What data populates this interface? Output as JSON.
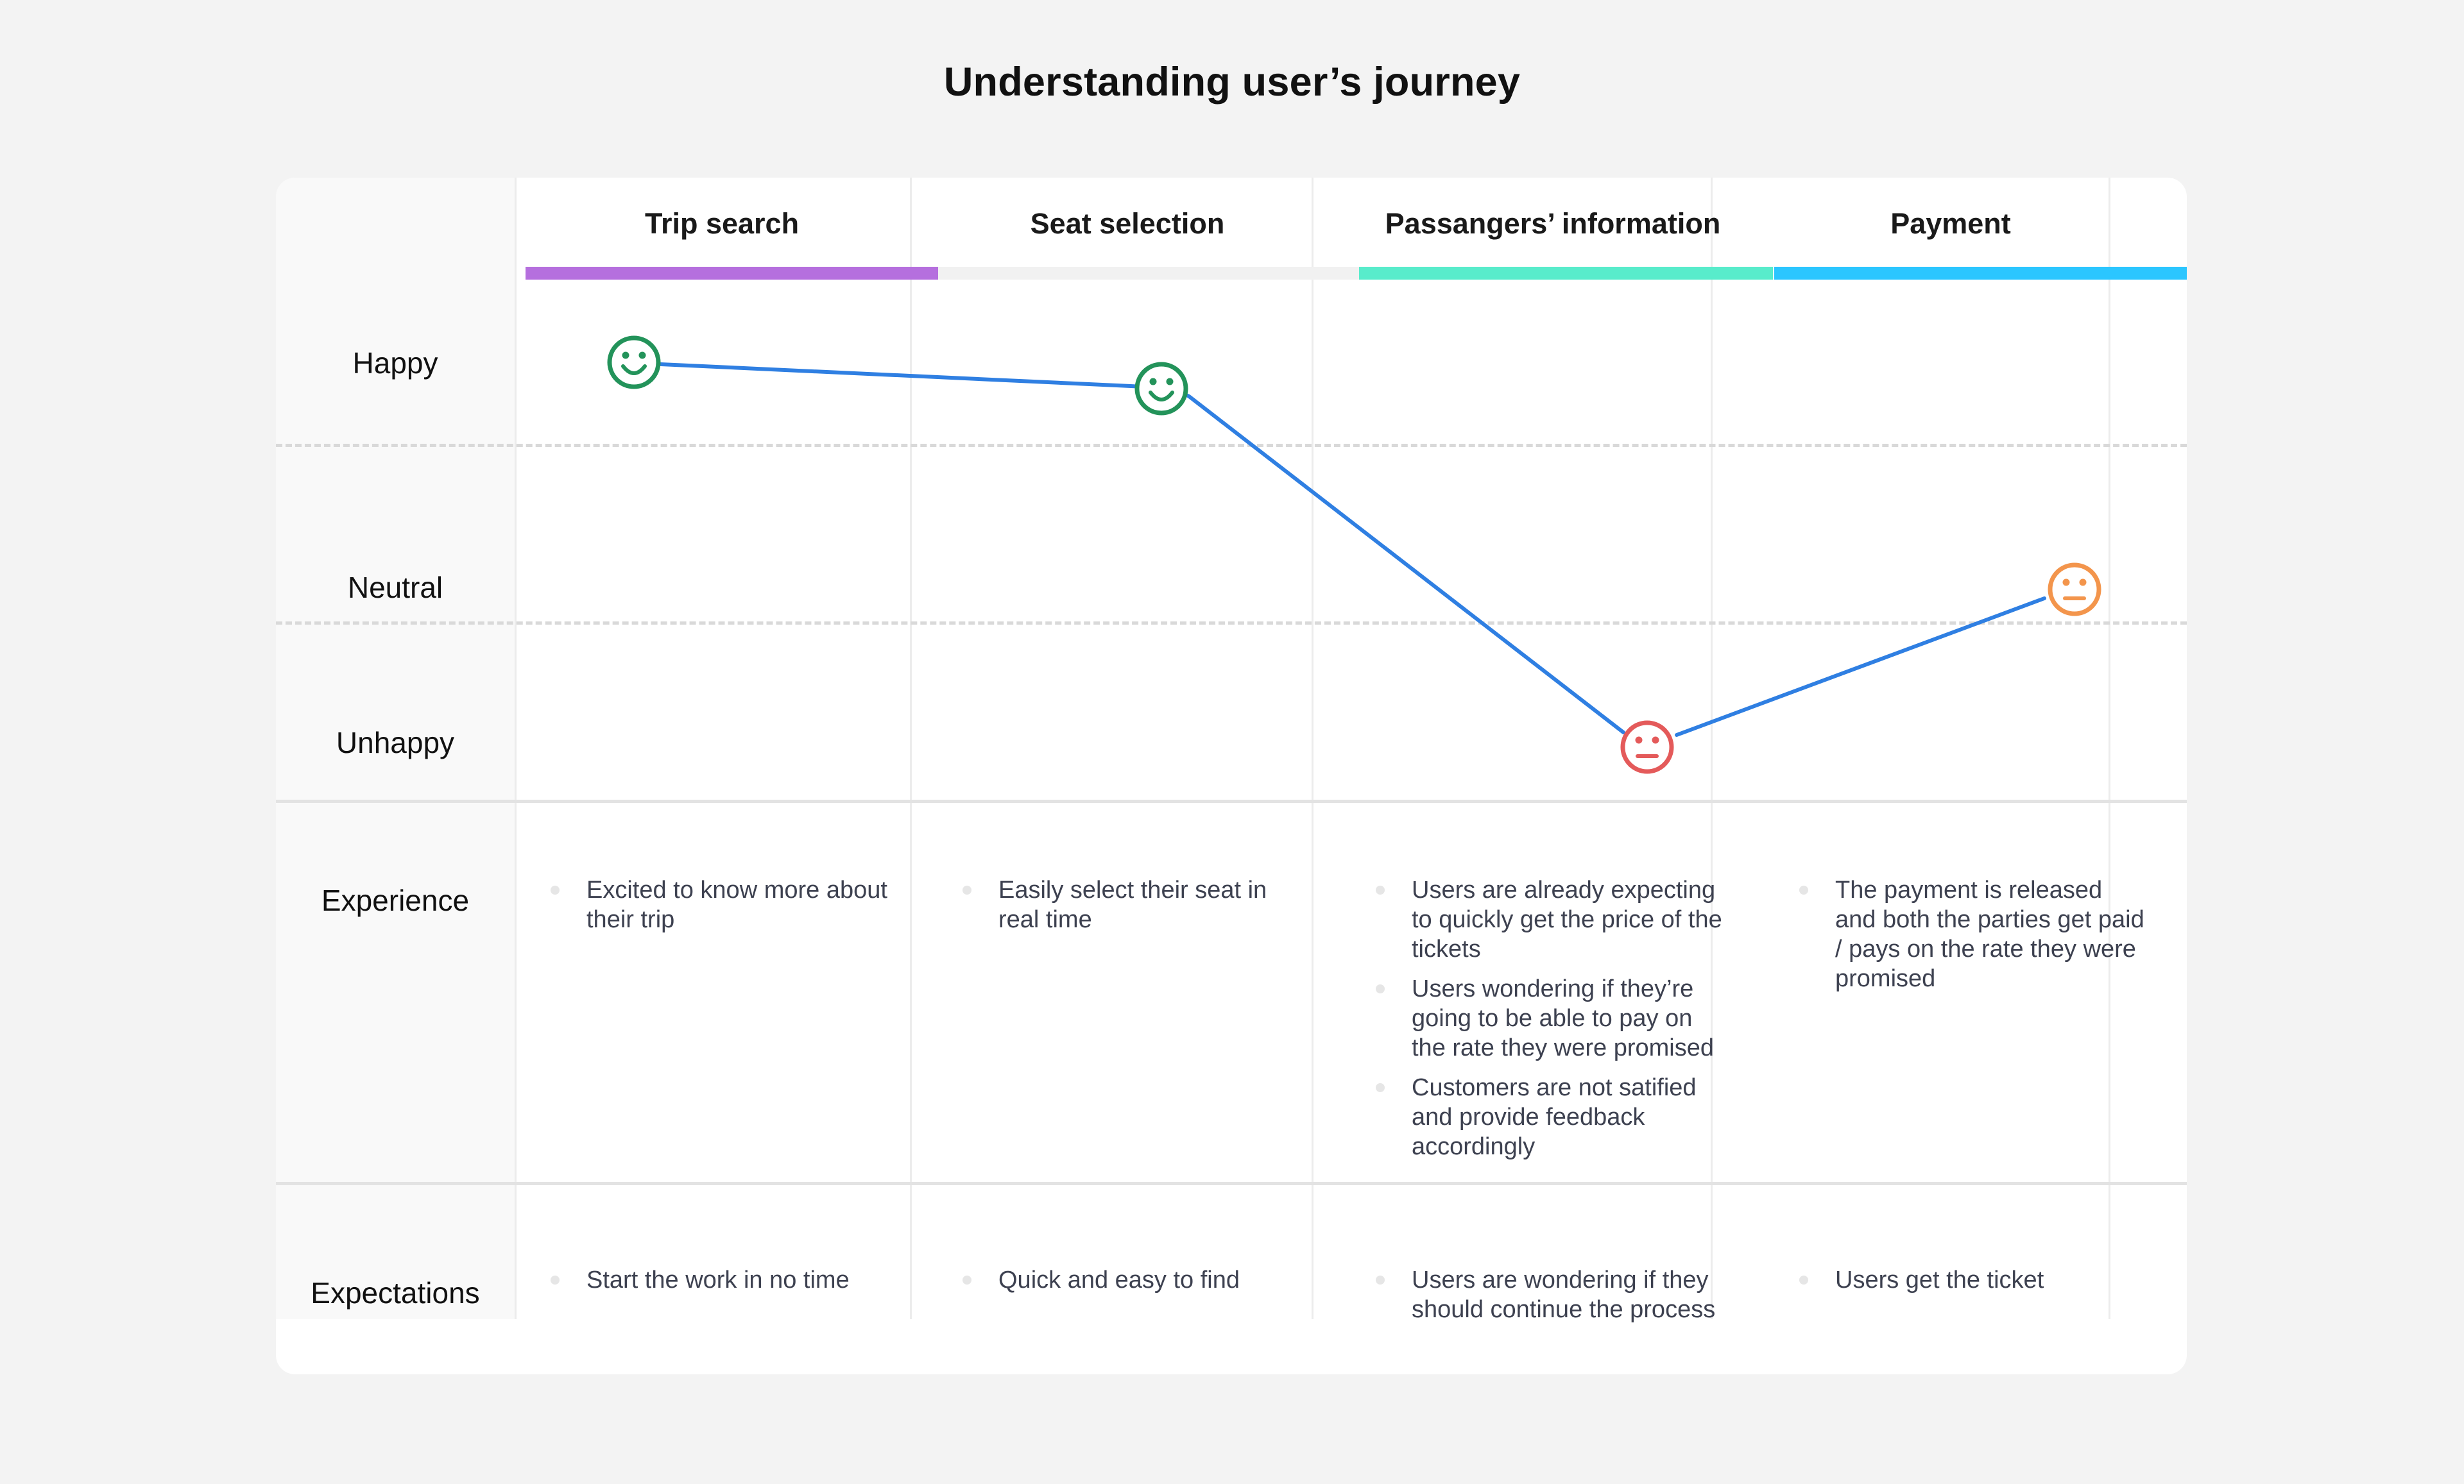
{
  "title": "Understanding user’s journey",
  "stages": [
    {
      "label": "Trip search",
      "color": "#b56fde"
    },
    {
      "label": "Seat selection",
      "color": "#f1f1f1"
    },
    {
      "label": "Passangers’ information",
      "color": "#58eccb"
    },
    {
      "label": "Payment",
      "color": "#2bc6ff"
    }
  ],
  "emotion_levels": {
    "happy": "Happy",
    "neutral": "Neutral",
    "unhappy": "Unhappy"
  },
  "rows": {
    "experience": "Experience",
    "expectations": "Expectations"
  },
  "chart_data": {
    "type": "line",
    "categories": [
      "Trip search",
      "Seat selection",
      "Passangers’ information",
      "Payment"
    ],
    "series": [
      {
        "values": [
          {
            "stage": "Trip search",
            "mood": "happy",
            "icon": "smile-icon",
            "color": "#23935a"
          },
          {
            "stage": "Seat selection",
            "mood": "happy",
            "icon": "smile-icon",
            "color": "#23935a"
          },
          {
            "stage": "Passangers’ information",
            "mood": "unhappy",
            "icon": "neutral-face-icon",
            "color": "#e45a5a"
          },
          {
            "stage": "Payment",
            "mood": "neutral",
            "icon": "neutral-face-icon",
            "color": "#f3954c"
          }
        ]
      }
    ],
    "line_color": "#2f7fe2"
  },
  "experience": [
    [
      "Excited to know more about their trip"
    ],
    [
      "Easily select their seat in real time"
    ],
    [
      "Users are already expecting to quickly get the price of the tickets",
      "Users wondering if they’re going to be able to pay on the rate they were promised",
      "Customers are not satified and provide feedback accordingly"
    ],
    [
      "The payment is released and both the parties get paid / pays on the rate they were promised"
    ]
  ],
  "expectations": [
    [
      "Start the work in no time"
    ],
    [
      "Quick and easy to find"
    ],
    [
      "Users are wondering if they should continue the process"
    ],
    [
      "Users get the ticket"
    ]
  ]
}
